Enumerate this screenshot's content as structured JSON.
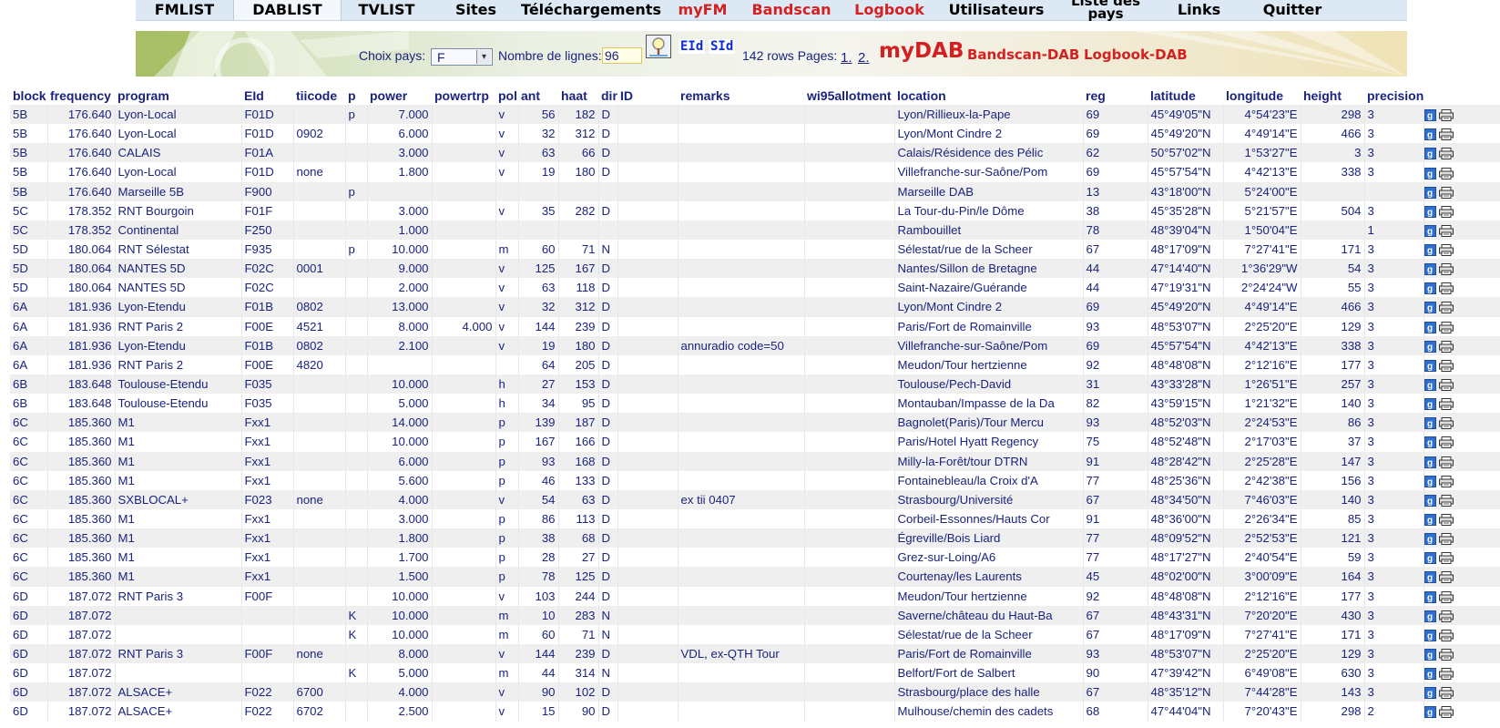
{
  "nav": [
    {
      "label": "FMLIST",
      "red": false,
      "active": false,
      "twoline": false
    },
    {
      "label": "DABLIST",
      "red": false,
      "active": true,
      "twoline": false
    },
    {
      "label": "TVLIST",
      "red": false,
      "active": false,
      "twoline": false
    },
    {
      "label": "Sites",
      "red": false,
      "active": false,
      "twoline": false
    },
    {
      "label": "Téléchargements",
      "red": false,
      "active": false,
      "twoline": false
    },
    {
      "label": "myFM",
      "red": true,
      "active": false,
      "twoline": false
    },
    {
      "label": "Bandscan",
      "red": true,
      "active": false,
      "twoline": false
    },
    {
      "label": "Logbook",
      "red": true,
      "active": false,
      "twoline": false
    },
    {
      "label": "Utilisateurs",
      "red": false,
      "active": false,
      "twoline": false
    },
    {
      "label": "Liste des pays",
      "red": false,
      "active": false,
      "twoline": true
    },
    {
      "label": "Links",
      "red": false,
      "active": false,
      "twoline": false
    },
    {
      "label": "Quitter",
      "red": false,
      "active": false,
      "twoline": false
    }
  ],
  "filters": {
    "country_label": "Choix pays:",
    "country_value": "F",
    "rows_label": "Nombre de lignes:",
    "rows_value": "96",
    "eid_label": "EId",
    "sid_label": "SId",
    "rows_count": "142 rows Pages:",
    "page1": "1.",
    "page2": "2.",
    "brand": "myDAB",
    "bandscan": "Bandscan-DAB",
    "logbook": "Logbook-DAB"
  },
  "colors": {
    "nav_bg": "#dce9f5",
    "accent_red": "#d42020",
    "text": "#1a237e",
    "row_alt": "#efefef"
  },
  "icons": {
    "row_icon_1": "google-maps-icon",
    "row_icon_2": "print-icon",
    "search": "magnifier-icon"
  },
  "table": {
    "columns": [
      "block",
      "frequency",
      "program",
      "EId",
      "tiicode",
      "p",
      "power",
      "powertrp",
      "pol",
      "ant",
      "haat",
      "dir",
      "ID",
      "remarks",
      "wi95allotment",
      "location",
      "reg",
      "latitude",
      "longitude",
      "height",
      "precision"
    ],
    "rows": [
      [
        "5B",
        "176.640",
        "Lyon-Local",
        "F01D",
        "",
        "p",
        "7.000",
        "",
        "v",
        "56",
        "182",
        "D",
        "",
        "",
        "",
        "Lyon/Rillieux-la-Pape",
        "69",
        "45°49'05\"N",
        "4°54'23\"E",
        "298",
        "3"
      ],
      [
        "5B",
        "176.640",
        "Lyon-Local",
        "F01D",
        "0902",
        "",
        "6.000",
        "",
        "v",
        "32",
        "312",
        "D",
        "",
        "",
        "",
        "Lyon/Mont Cindre 2",
        "69",
        "45°49'20\"N",
        "4°49'14\"E",
        "466",
        "3"
      ],
      [
        "5B",
        "176.640",
        "CALAIS",
        "F01A",
        "",
        "",
        "3.000",
        "",
        "v",
        "63",
        "66",
        "D",
        "",
        "",
        "",
        "Calais/Résidence des Pélic",
        "62",
        "50°57'02\"N",
        "1°53'27\"E",
        "3",
        "3"
      ],
      [
        "5B",
        "176.640",
        "Lyon-Local",
        "F01D",
        "none",
        "",
        "1.800",
        "",
        "v",
        "19",
        "180",
        "D",
        "",
        "",
        "",
        "Villefranche-sur-Saône/Pom",
        "69",
        "45°57'54\"N",
        "4°42'13\"E",
        "338",
        "3"
      ],
      [
        "5B",
        "176.640",
        "Marseille 5B",
        "F900",
        "",
        "p",
        "",
        "",
        "",
        "",
        "",
        "",
        "",
        "",
        "",
        "Marseille DAB",
        "13",
        "43°18'00\"N",
        "5°24'00\"E",
        "",
        ""
      ],
      [
        "5C",
        "178.352",
        "RNT Bourgoin",
        "F01F",
        "",
        "",
        "3.000",
        "",
        "v",
        "35",
        "282",
        "D",
        "",
        "",
        "",
        "La Tour-du-Pin/le Dôme",
        "38",
        "45°35'28\"N",
        "5°21'57\"E",
        "504",
        "3"
      ],
      [
        "5C",
        "178.352",
        "Continental",
        "F250",
        "",
        "",
        "1.000",
        "",
        "",
        "",
        "",
        "",
        "",
        "",
        "",
        "Rambouillet",
        "78",
        "48°39'04\"N",
        "1°50'04\"E",
        "",
        "1"
      ],
      [
        "5D",
        "180.064",
        "RNT Sélestat",
        "F935",
        "",
        "p",
        "10.000",
        "",
        "m",
        "60",
        "71",
        "N",
        "",
        "",
        "",
        "Sélestat/rue de la Scheer",
        "67",
        "48°17'09\"N",
        "7°27'41\"E",
        "171",
        "3"
      ],
      [
        "5D",
        "180.064",
        "NANTES 5D",
        "F02C",
        "0001",
        "",
        "9.000",
        "",
        "v",
        "125",
        "167",
        "D",
        "",
        "",
        "",
        "Nantes/Sillon de Bretagne",
        "44",
        "47°14'40\"N",
        "1°36'29\"W",
        "54",
        "3"
      ],
      [
        "5D",
        "180.064",
        "NANTES 5D",
        "F02C",
        "",
        "",
        "2.000",
        "",
        "v",
        "63",
        "118",
        "D",
        "",
        "",
        "",
        "Saint-Nazaire/Guérande",
        "44",
        "47°19'31\"N",
        "2°24'24\"W",
        "55",
        "3"
      ],
      [
        "6A",
        "181.936",
        "Lyon-Etendu",
        "F01B",
        "0802",
        "",
        "13.000",
        "",
        "v",
        "32",
        "312",
        "D",
        "",
        "",
        "",
        "Lyon/Mont Cindre 2",
        "69",
        "45°49'20\"N",
        "4°49'14\"E",
        "466",
        "3"
      ],
      [
        "6A",
        "181.936",
        "RNT Paris 2",
        "F00E",
        "4521",
        "",
        "8.000",
        "4.000",
        "v",
        "144",
        "239",
        "D",
        "",
        "",
        "",
        "Paris/Fort de Romainville",
        "93",
        "48°53'07\"N",
        "2°25'20\"E",
        "129",
        "3"
      ],
      [
        "6A",
        "181.936",
        "Lyon-Etendu",
        "F01B",
        "0802",
        "",
        "2.100",
        "",
        "v",
        "19",
        "180",
        "D",
        "",
        "annuradio code=50",
        "",
        "Villefranche-sur-Saône/Pom",
        "69",
        "45°57'54\"N",
        "4°42'13\"E",
        "338",
        "3"
      ],
      [
        "6A",
        "181.936",
        "RNT Paris 2",
        "F00E",
        "4820",
        "",
        "",
        "",
        "",
        "64",
        "205",
        "D",
        "",
        "",
        "",
        "Meudon/Tour hertzienne",
        "92",
        "48°48'08\"N",
        "2°12'16\"E",
        "177",
        "3"
      ],
      [
        "6B",
        "183.648",
        "Toulouse-Etendu",
        "F035",
        "",
        "",
        "10.000",
        "",
        "h",
        "27",
        "153",
        "D",
        "",
        "",
        "",
        "Toulouse/Pech-David",
        "31",
        "43°33'28\"N",
        "1°26'51\"E",
        "257",
        "3"
      ],
      [
        "6B",
        "183.648",
        "Toulouse-Etendu",
        "F035",
        "",
        "",
        "5.000",
        "",
        "h",
        "34",
        "95",
        "D",
        "",
        "",
        "",
        "Montauban/Impasse de la Da",
        "82",
        "43°59'15\"N",
        "1°21'32\"E",
        "140",
        "3"
      ],
      [
        "6C",
        "185.360",
        "M1",
        "Fxx1",
        "",
        "",
        "14.000",
        "",
        "p",
        "139",
        "187",
        "D",
        "",
        "",
        "",
        "Bagnolet(Paris)/Tour Mercu",
        "93",
        "48°52'03\"N",
        "2°24'53\"E",
        "86",
        "3"
      ],
      [
        "6C",
        "185.360",
        "M1",
        "Fxx1",
        "",
        "",
        "10.000",
        "",
        "p",
        "167",
        "166",
        "D",
        "",
        "",
        "",
        "Paris/Hotel Hyatt Regency",
        "75",
        "48°52'48\"N",
        "2°17'03\"E",
        "37",
        "3"
      ],
      [
        "6C",
        "185.360",
        "M1",
        "Fxx1",
        "",
        "",
        "6.000",
        "",
        "p",
        "93",
        "168",
        "D",
        "",
        "",
        "",
        "Milly-la-Forêt/tour DTRN",
        "91",
        "48°28'42\"N",
        "2°25'28\"E",
        "147",
        "3"
      ],
      [
        "6C",
        "185.360",
        "M1",
        "Fxx1",
        "",
        "",
        "5.600",
        "",
        "p",
        "46",
        "133",
        "D",
        "",
        "",
        "",
        "Fontainebleau/la Croix d'A",
        "77",
        "48°25'36\"N",
        "2°42'38\"E",
        "156",
        "3"
      ],
      [
        "6C",
        "185.360",
        "SXBLOCAL+",
        "F023",
        "none",
        "",
        "4.000",
        "",
        "v",
        "54",
        "63",
        "D",
        "",
        "ex tii 0407",
        "",
        "Strasbourg/Université",
        "67",
        "48°34'50\"N",
        "7°46'03\"E",
        "140",
        "3"
      ],
      [
        "6C",
        "185.360",
        "M1",
        "Fxx1",
        "",
        "",
        "3.000",
        "",
        "p",
        "86",
        "113",
        "D",
        "",
        "",
        "",
        "Corbeil-Essonnes/Hauts Cor",
        "91",
        "48°36'00\"N",
        "2°26'34\"E",
        "85",
        "3"
      ],
      [
        "6C",
        "185.360",
        "M1",
        "Fxx1",
        "",
        "",
        "1.800",
        "",
        "p",
        "38",
        "68",
        "D",
        "",
        "",
        "",
        "Égreville/Bois Liard",
        "77",
        "48°09'52\"N",
        "2°52'53\"E",
        "121",
        "3"
      ],
      [
        "6C",
        "185.360",
        "M1",
        "Fxx1",
        "",
        "",
        "1.700",
        "",
        "p",
        "28",
        "27",
        "D",
        "",
        "",
        "",
        "Grez-sur-Loing/A6",
        "77",
        "48°17'27\"N",
        "2°40'54\"E",
        "59",
        "3"
      ],
      [
        "6C",
        "185.360",
        "M1",
        "Fxx1",
        "",
        "",
        "1.500",
        "",
        "p",
        "78",
        "125",
        "D",
        "",
        "",
        "",
        "Courtenay/les Laurents",
        "45",
        "48°02'00\"N",
        "3°00'09\"E",
        "164",
        "3"
      ],
      [
        "6D",
        "187.072",
        "RNT Paris 3",
        "F00F",
        "",
        "",
        "10.000",
        "",
        "v",
        "103",
        "244",
        "D",
        "",
        "",
        "",
        "Meudon/Tour hertzienne",
        "92",
        "48°48'08\"N",
        "2°12'16\"E",
        "177",
        "3"
      ],
      [
        "6D",
        "187.072",
        "",
        "",
        "",
        "K",
        "10.000",
        "",
        "m",
        "10",
        "283",
        "N",
        "",
        "",
        "",
        "Saverne/château du Haut-Ba",
        "67",
        "48°43'31\"N",
        "7°20'20\"E",
        "430",
        "3"
      ],
      [
        "6D",
        "187.072",
        "",
        "",
        "",
        "K",
        "10.000",
        "",
        "m",
        "60",
        "71",
        "N",
        "",
        "",
        "",
        "Sélestat/rue de la Scheer",
        "67",
        "48°17'09\"N",
        "7°27'41\"E",
        "171",
        "3"
      ],
      [
        "6D",
        "187.072",
        "RNT Paris 3",
        "F00F",
        "none",
        "",
        "8.000",
        "",
        "v",
        "144",
        "239",
        "D",
        "",
        "VDL, ex-QTH Tour",
        "",
        "Paris/Fort de Romainville",
        "93",
        "48°53'07\"N",
        "2°25'20\"E",
        "129",
        "3"
      ],
      [
        "6D",
        "187.072",
        "",
        "",
        "",
        "K",
        "5.000",
        "",
        "m",
        "44",
        "314",
        "N",
        "",
        "",
        "",
        "Belfort/Fort de Salbert",
        "90",
        "47°39'42\"N",
        "6°49'08\"E",
        "630",
        "3"
      ],
      [
        "6D",
        "187.072",
        "ALSACE+",
        "F022",
        "6700",
        "",
        "4.000",
        "",
        "v",
        "90",
        "102",
        "D",
        "",
        "",
        "",
        "Strasbourg/place des halle",
        "67",
        "48°35'12\"N",
        "7°44'28\"E",
        "143",
        "3"
      ],
      [
        "6D",
        "187.072",
        "ALSACE+",
        "F022",
        "6702",
        "",
        "2.500",
        "",
        "v",
        "15",
        "90",
        "D",
        "",
        "",
        "",
        "Mulhouse/chemin des cadets",
        "68",
        "47°44'04\"N",
        "7°20'43\"E",
        "298",
        "2"
      ]
    ]
  }
}
